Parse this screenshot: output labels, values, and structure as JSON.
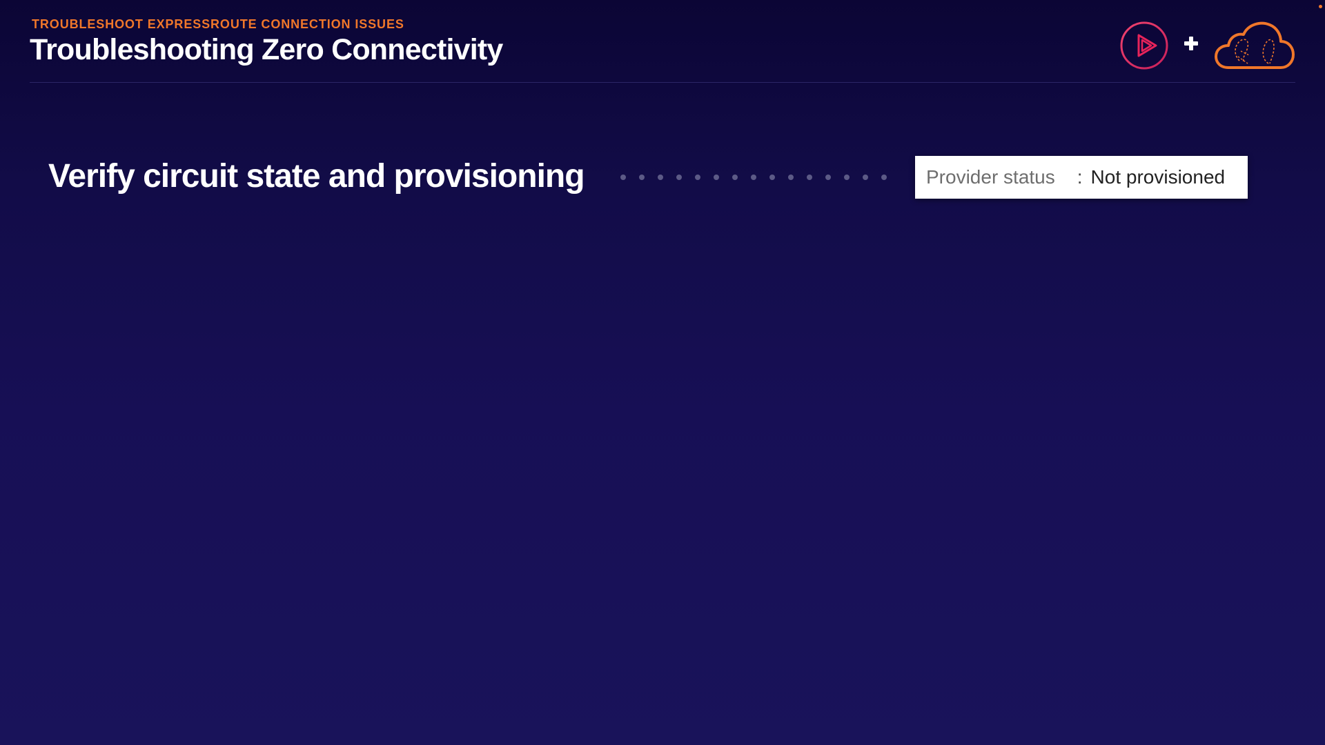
{
  "header": {
    "eyebrow": "TROUBLESHOOT EXPRESSROUTE CONNECTION ISSUES",
    "title": "Troubleshooting Zero Connectivity"
  },
  "logos": {
    "left_icon": "play-circle-icon",
    "separator": "+",
    "right_icon": "cloud-icon"
  },
  "step": {
    "text": "Verify circuit state and provisioning"
  },
  "status_card": {
    "label": "Provider status",
    "separator": ":",
    "value": "Not provisioned"
  },
  "colors": {
    "background_top": "#0b0535",
    "background_bottom": "#19135a",
    "accent_orange": "#f0772a",
    "accent_pink": "#e8235a",
    "text_white": "#ffffff",
    "dot_leader": "#5c5a86"
  }
}
